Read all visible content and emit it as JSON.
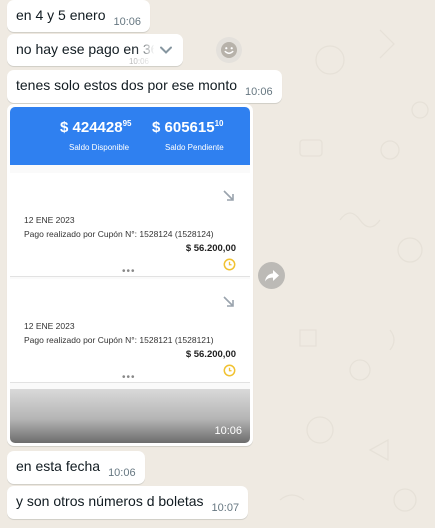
{
  "messages": [
    {
      "text": "en 4 y 5 enero",
      "time": "10:06"
    },
    {
      "text": "no hay ese pago en 360",
      "time": "10:06"
    },
    {
      "text": "tenes solo estos dos por ese monto",
      "time": "10:06"
    },
    {
      "text": "en esta fecha",
      "time": "10:06"
    },
    {
      "text": "y son otros números d boletas",
      "time": "10:07"
    }
  ],
  "image_message": {
    "time": "10:06",
    "balance_available": {
      "main": "$ 424428",
      "cents": "95",
      "label": "Saldo Disponible"
    },
    "balance_pending": {
      "main": "$ 605615",
      "cents": "10",
      "label": "Saldo Pendiente"
    },
    "payments": [
      {
        "date": "12 ENE 2023",
        "description": "Pago realizado por Cupón N°: 1528124 (1528124)",
        "amount": "$ 56.200,00"
      },
      {
        "date": "12 ENE 2023",
        "description": "Pago realizado por Cupón N°: 1528121 (1528121)",
        "amount": "$ 56.200,00"
      }
    ],
    "more": "•••"
  },
  "icons": {
    "menu": "chevron-down-icon",
    "reaction": "smiley-icon",
    "forward": "forward-icon",
    "arrow": "diagonal-arrow-icon",
    "pending": "clock-icon"
  },
  "colors": {
    "chat_bg": "#efeae2",
    "bubble": "#ffffff",
    "header_blue": "#2f80f0",
    "clock_yellow": "#f1c232"
  }
}
